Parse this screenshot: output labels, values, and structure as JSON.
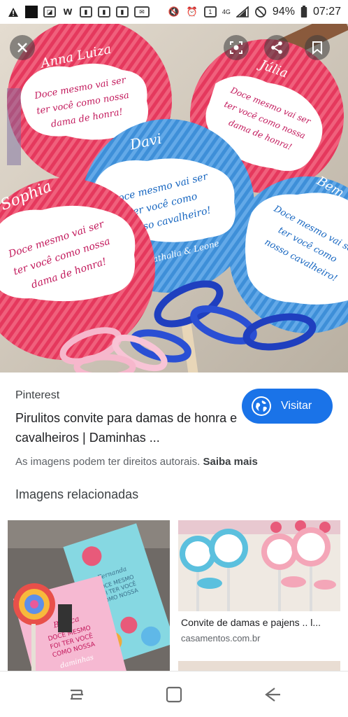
{
  "status_bar": {
    "signal_label": "4G",
    "battery_text": "94%",
    "time": "07:27",
    "icons": [
      "warning-icon",
      "app-icon",
      "gallery-icon",
      "w-app-icon",
      "notification-icon",
      "notification-icon",
      "notification-icon",
      "email-icon",
      "mute-icon",
      "alarm-icon",
      "one-icon",
      "signal-icon",
      "dnd-icon",
      "battery-icon"
    ]
  },
  "hero": {
    "overlay_buttons": [
      "close-icon",
      "lens-icon",
      "share-icon",
      "bookmark-icon"
    ],
    "lollipops": [
      {
        "name": "Anna Luiza",
        "message": "Doce mesmo vai ser ter você como nossa dama de honra!",
        "color": "#e5385d"
      },
      {
        "name": "Júlia",
        "message": "Doce mesmo vai ser ter você como nossa dama de honra!",
        "color": "#e5385d"
      },
      {
        "name": "Davi",
        "message": "Doce mesmo vai ser ter você como nosso cavalheiro!",
        "color": "#3e8fd8"
      },
      {
        "name": "Sophia",
        "message": "Doce mesmo vai ser ter você como nossa dama de honra!",
        "color": "#e5385d"
      },
      {
        "name": "Bem",
        "message": "Doce mesmo vai ser ter você como nosso cavalheiro!",
        "color": "#3e8fd8"
      }
    ],
    "couple": "Nathalia & Leone"
  },
  "info": {
    "source": "Pinterest",
    "title": "Pirulitos convite para damas de honra e cavalheiros | Daminhas ...",
    "visit_label": "Visitar",
    "copyright": "As imagens podem ter direitos autorais.",
    "learn_more": "Saiba mais",
    "related_heading": "Imagens relacionadas",
    "accent_color": "#1a73e8"
  },
  "related": [
    {
      "caption": "",
      "domain": "",
      "thumb_text": [
        "Bianca",
        "DOCE MESMO",
        "FOI TER VOCÊ",
        "COMO NOSSA",
        "daminhas"
      ]
    },
    {
      "caption": "Convite de damas e pajens .. l...",
      "domain": "casamentos.com.br"
    }
  ],
  "navbar": {
    "buttons": [
      "recent-apps-icon",
      "home-icon",
      "back-icon"
    ]
  }
}
